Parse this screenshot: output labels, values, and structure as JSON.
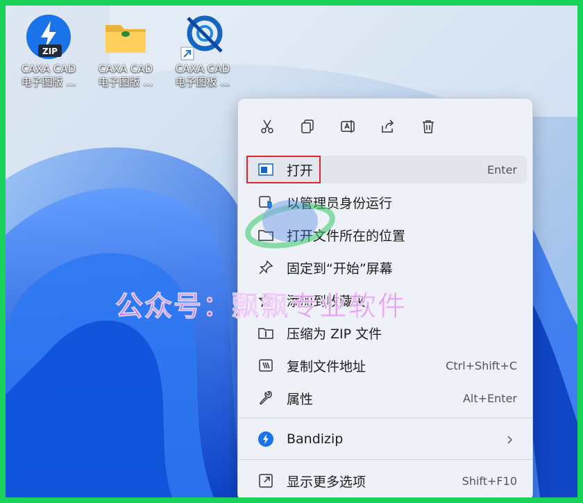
{
  "desktop": {
    "icons": [
      {
        "line1": "CAXA CAD",
        "line2": "电子图版 ...",
        "icon": "zip-archive-icon"
      },
      {
        "line1": "CAXA CAD",
        "line2": "电子图版 ...",
        "icon": "folder-icon"
      },
      {
        "line1": "CAXA CAD",
        "line2": "电子图板 ...",
        "icon": "caxa-app-shortcut-icon"
      }
    ]
  },
  "context_menu": {
    "quick_actions": [
      {
        "name": "cut",
        "icon": "scissors-icon"
      },
      {
        "name": "copy",
        "icon": "copy-icon"
      },
      {
        "name": "rename",
        "icon": "rename-icon"
      },
      {
        "name": "share",
        "icon": "share-icon"
      },
      {
        "name": "delete",
        "icon": "trash-icon"
      }
    ],
    "items": [
      {
        "label": "打开",
        "shortcut": "Enter",
        "icon": "open-window-icon"
      },
      {
        "label": "以管理员身份运行",
        "shortcut": "",
        "icon": "shield-icon"
      },
      {
        "label": "打开文件所在的位置",
        "shortcut": "",
        "icon": "folder-icon"
      },
      {
        "label": "固定到“开始”屏幕",
        "shortcut": "",
        "icon": "pin-icon"
      },
      {
        "label": "添加到收藏夹",
        "shortcut": "",
        "icon": "star-icon"
      },
      {
        "label": "压缩为 ZIP 文件",
        "shortcut": "",
        "icon": "zip-folder-icon"
      },
      {
        "label": "复制文件地址",
        "shortcut": "Ctrl+Shift+C",
        "icon": "copy-path-icon"
      },
      {
        "label": "属性",
        "shortcut": "Alt+Enter",
        "icon": "wrench-icon"
      },
      {
        "label": "Bandizip",
        "shortcut": "",
        "icon": "bandizip-icon"
      },
      {
        "label": "显示更多选项",
        "shortcut": "Shift+F10",
        "icon": "more-options-icon"
      }
    ]
  },
  "watermark": {
    "text": "公众号：飘飘专业软件"
  },
  "colors": {
    "frame_border": "#19d35a",
    "highlight_box": "#e0262b",
    "watermark": "#be46e6"
  }
}
